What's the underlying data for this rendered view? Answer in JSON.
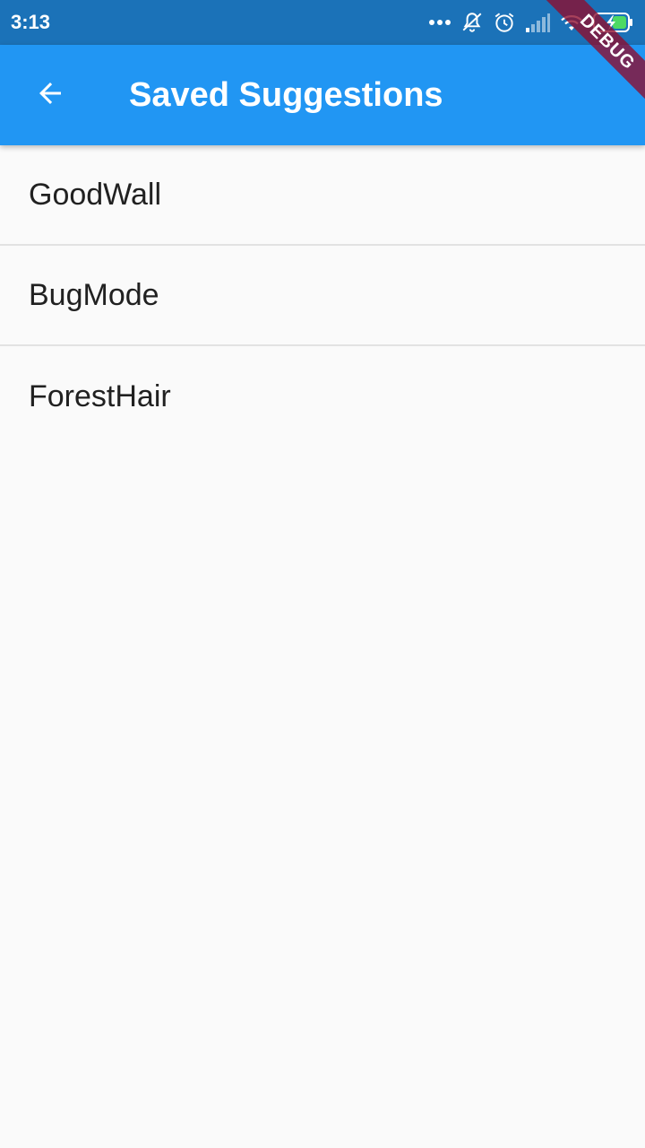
{
  "status_bar": {
    "time": "3:13",
    "icons": [
      "more-dots-icon",
      "notifications-off-icon",
      "alarm-icon",
      "signal-icon",
      "wifi-icon",
      "battery-charging-icon"
    ]
  },
  "app_bar": {
    "back_icon": "arrow-left-icon",
    "title": "Saved Suggestions"
  },
  "saved_list": {
    "items": [
      {
        "label": "GoodWall"
      },
      {
        "label": "BugMode"
      },
      {
        "label": "ForestHair"
      }
    ]
  },
  "debug_banner": {
    "label": "DEBUG"
  },
  "colors": {
    "status_bar_bg": "#1b72b8",
    "app_bar_bg": "#2196f3",
    "background": "#fafafa",
    "divider": "#e2e2e2",
    "text_primary": "#212121",
    "debug_ribbon": "#8e0b2d",
    "battery_fill": "#4cd964"
  }
}
